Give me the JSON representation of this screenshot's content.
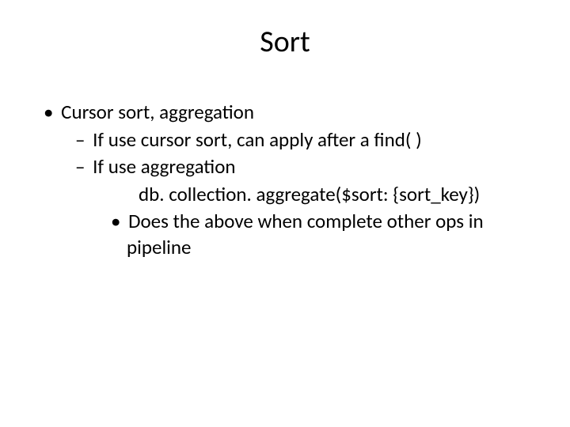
{
  "slide": {
    "title": "Sort",
    "bullets": {
      "l1_1": "Cursor sort, aggregation",
      "l2_1": "If use cursor sort, can apply after a find( )",
      "l2_2": "If use aggregation",
      "l3_1": "db. collection. aggregate($sort: {sort_key})",
      "l4_1": "Does the above when complete other ops in pipeline"
    }
  }
}
